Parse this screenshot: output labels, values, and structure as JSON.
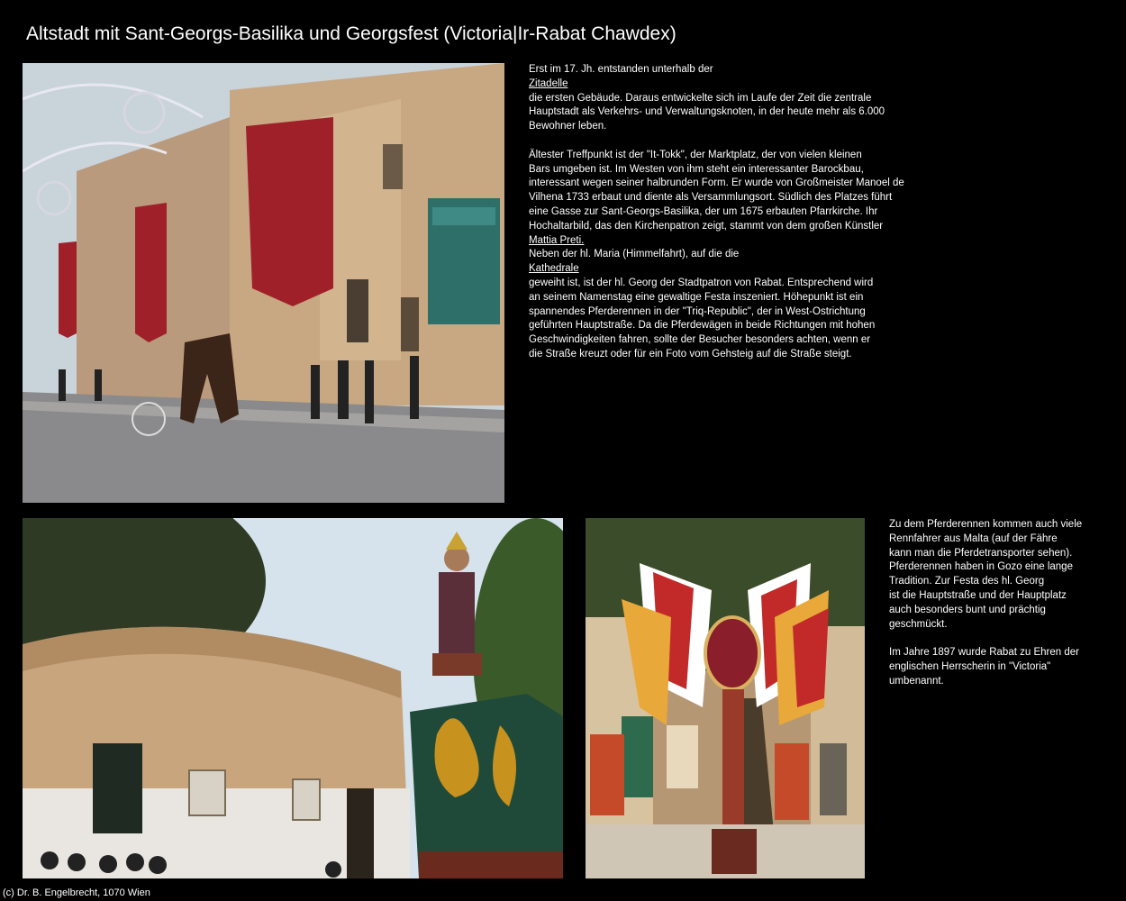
{
  "page": {
    "title": "Altstadt mit Sant-Georgs-Basilika und Georgsfest (Victoria|Ir-Rabat Chawdex)",
    "footer": "(c) Dr. B. Engelbrecht, 1070 Wien"
  },
  "text_block_1": {
    "line_01": "Erst im 17. Jh. entstanden unterhalb der",
    "link_01": "Zitadelle",
    "line_02": "die ersten Gebäude. Daraus entwickelte sich im Laufe der Zeit die zentrale",
    "line_03": "Hauptstadt als Verkehrs- und Verwaltungsknoten, in der heute mehr als 6.000",
    "line_04": "Bewohner leben.",
    "line_05": "Ältester Treffpunkt ist der \"It-Tokk\", der Marktplatz, der von vielen kleinen",
    "line_06": "Bars umgeben ist. Im Westen von ihm steht ein interessanter Barockbau,",
    "line_07": "interessant wegen seiner halbrunden Form. Er wurde von Großmeister Manoel de",
    "line_08": "Vilhena 1733 erbaut und diente als Versammlungsort. Südlich des Platzes führt",
    "line_09": "eine Gasse zur Sant-Georgs-Basilika, der um 1675 erbauten Pfarrkirche. Ihr",
    "line_10": "Hochaltarbild, das den Kirchenpatron zeigt, stammt von dem großen Künstler",
    "link_02": "Mattia Preti.",
    "line_11": "Neben der hl. Maria (Himmelfahrt), auf die die",
    "link_03": "Kathedrale",
    "line_12": "geweiht ist, ist der hl. Georg der Stadtpatron von Rabat. Entsprechend wird",
    "line_13": "an seinem Namenstag eine gewaltige Festa inszeniert. Höhepunkt ist ein",
    "line_14": "spannendes Pferderennen in der \"Triq-Republic\", der in West-Ostrichtung",
    "line_15": "geführten Hauptstraße. Da die Pferdewägen in beide Richtungen mit hohen",
    "line_16": "Geschwindigkeiten fahren, sollte der Besucher besonders achten, wenn er",
    "line_17": "die Straße kreuzt oder für ein Foto vom Gehsteig auf die Straße steigt."
  },
  "text_block_2": {
    "line_01": "Zu dem Pferderennen kommen auch viele",
    "line_02": "Rennfahrer aus Malta (auf der Fähre",
    "line_03": "kann man die Pferdetransporter sehen).",
    "line_04": "Pferderennen haben in Gozo eine lange",
    "line_05": "Tradition. Zur Festa des hl. Georg",
    "line_06": "ist die Hauptstraße und der Hauptplatz",
    "line_07": "auch besonders bunt und prächtig",
    "line_08": "geschmückt.",
    "line_09": "Im Jahre 1897 wurde Rabat zu Ehren der",
    "line_10": "englischen Herrscherin in \"Victoria\"",
    "line_11": "umbenannt."
  },
  "colors": {
    "background": "#000000",
    "text": "#ffffff",
    "sky": "#c9d6df",
    "sandstone": "#c9a57e",
    "banner_red": "#a0202a",
    "flag_yellow": "#e8a93a"
  }
}
